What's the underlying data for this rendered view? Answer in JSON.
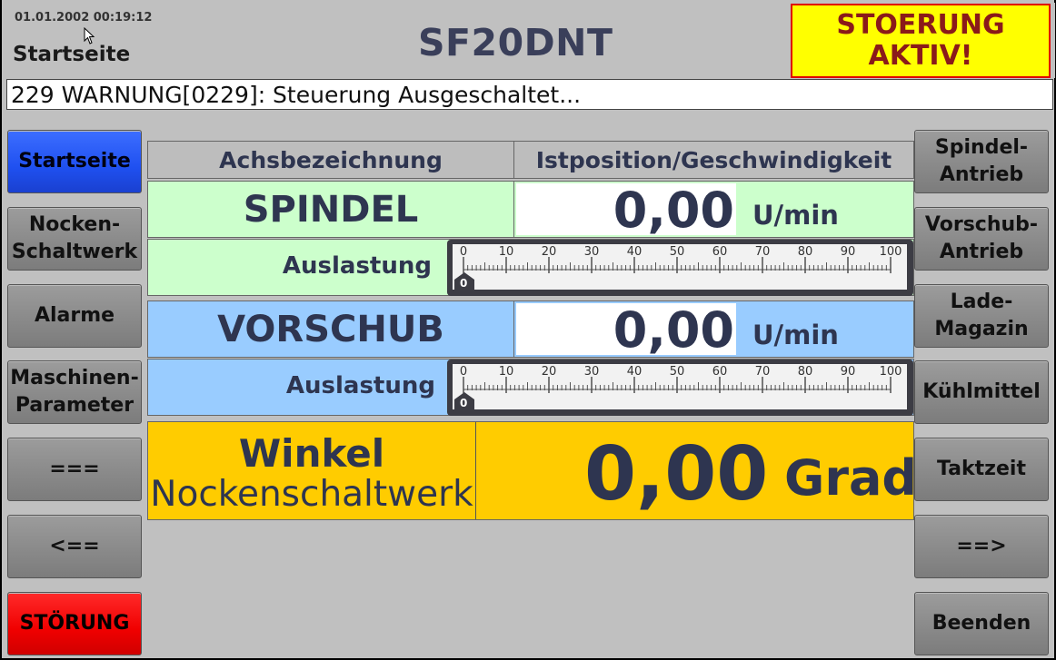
{
  "header": {
    "datetime": "01.01.2002 00:19:12",
    "page_name": "Startseite",
    "title": "SF20DNT",
    "alarm_line1": "STOERUNG",
    "alarm_line2": "AKTIV!"
  },
  "message": "229 WARNUNG[0229]: Steuerung Ausgeschaltet...",
  "left_nav": [
    {
      "label": "Startseite"
    },
    {
      "label": "Nocken-\nSchaltwerk"
    },
    {
      "label": "Alarme"
    },
    {
      "label": "Maschinen-\nParameter"
    },
    {
      "label": "==="
    },
    {
      "label": "<=="
    },
    {
      "label": "STÖRUNG"
    }
  ],
  "right_nav": [
    {
      "label": "Spindel-\nAntrieb"
    },
    {
      "label": "Vorschub-\nAntrieb"
    },
    {
      "label": "Lade-\nMagazin"
    },
    {
      "label": "Kühlmittel"
    },
    {
      "label": "Taktzeit"
    },
    {
      "label": "==>"
    },
    {
      "label": "Beenden"
    }
  ],
  "table": {
    "col1_header": "Achsbezeichnung",
    "col2_header": "Istposition/Geschwindigkeit",
    "axes": [
      {
        "name": "SPINDEL",
        "value": "0,00",
        "unit": "U/min",
        "load_label": "Auslastung",
        "load_value": 0,
        "color": "#ccffcc"
      },
      {
        "name": "VORSCHUB",
        "value": "0,00",
        "unit": "U/min",
        "load_label": "Auslastung",
        "load_value": 0,
        "color": "#99ccff"
      }
    ],
    "gauge_ticks": [
      "0",
      "10",
      "20",
      "30",
      "40",
      "50",
      "60",
      "70",
      "80",
      "90",
      "100"
    ],
    "gauge_marker_text": "0"
  },
  "winkel": {
    "title": "Winkel",
    "subtitle": "Nockenschaltwerk",
    "value": "0,00",
    "unit": "Grad"
  },
  "colors": {
    "alarm_bg": "#ffff00",
    "alarm_border": "#e00000",
    "active_nav": "#1f50f0",
    "stoerung_btn": "#f00000",
    "winkel_bg": "#ffcc00"
  }
}
